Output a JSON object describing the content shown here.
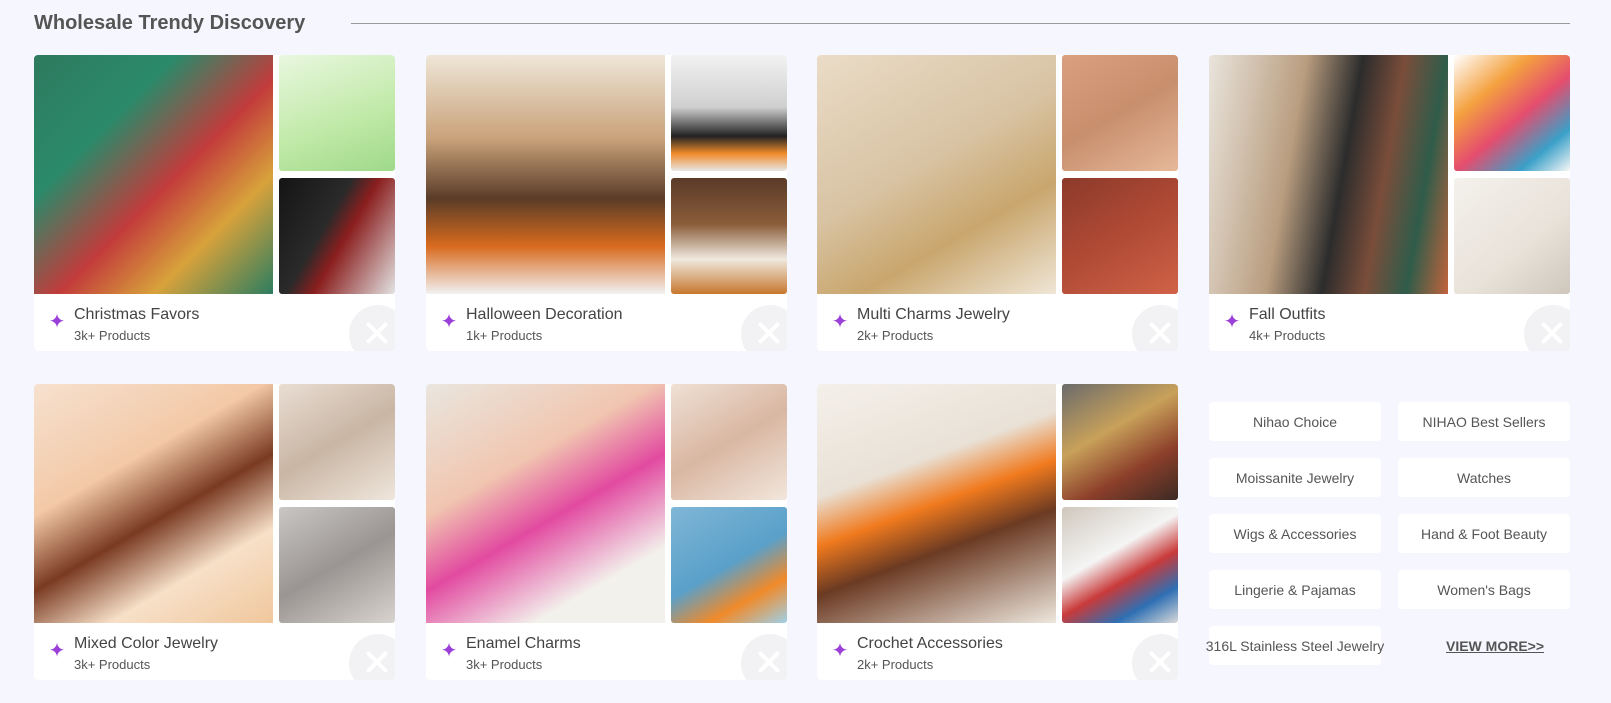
{
  "section": {
    "title": "Wholesale Trendy Discovery"
  },
  "cards": [
    {
      "name": "Christmas Favors",
      "count": "3k+ Products"
    },
    {
      "name": "Halloween Decoration",
      "count": "1k+ Products"
    },
    {
      "name": "Multi Charms Jewelry",
      "count": "2k+ Products"
    },
    {
      "name": "Fall Outfits",
      "count": "4k+ Products"
    },
    {
      "name": "Mixed Color Jewelry",
      "count": "3k+ Products"
    },
    {
      "name": "Enamel Charms",
      "count": "3k+ Products"
    },
    {
      "name": "Crochet Accessories",
      "count": "2k+ Products"
    }
  ],
  "tags": [
    "Nihao Choice",
    "NIHAO Best Sellers",
    "Moissanite Jewelry",
    "Watches",
    "Wigs & Accessories",
    "Hand & Foot Beauty",
    "Lingerie & Pajamas",
    "Women's Bags",
    "316L Stainless Steel Jewelry"
  ],
  "view_more": "VIEW MORE>>",
  "icons": {
    "sparkle": "sparkle-icon",
    "logo": "nihao-logo-icon"
  },
  "colors": {
    "accent": "#9c3fd9",
    "background": "#f6f7fe"
  }
}
